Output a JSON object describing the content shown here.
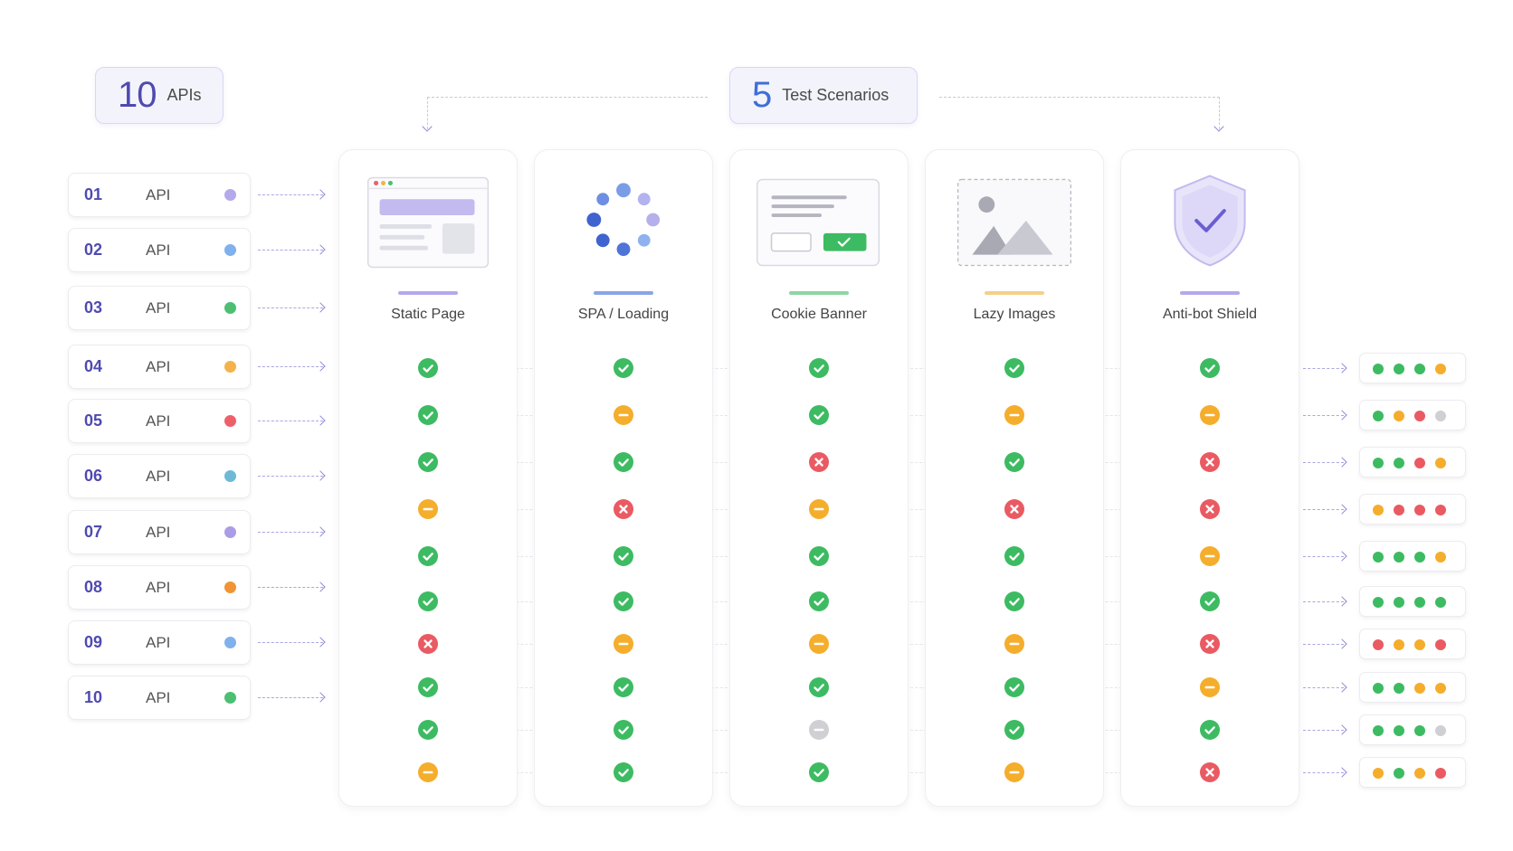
{
  "header": {
    "apis": {
      "count": "10",
      "label": "APIs"
    },
    "scenarios": {
      "count": "5",
      "label": "Test Scenarios"
    }
  },
  "apis": [
    {
      "index": "01",
      "name": "API",
      "color": "#b3a9ec"
    },
    {
      "index": "02",
      "name": "API",
      "color": "#7fb1ec"
    },
    {
      "index": "03",
      "name": "API",
      "color": "#4cbf73"
    },
    {
      "index": "04",
      "name": "API",
      "color": "#f4b34a"
    },
    {
      "index": "05",
      "name": "API",
      "color": "#ee6069"
    },
    {
      "index": "06",
      "name": "API",
      "color": "#6db9d6"
    },
    {
      "index": "07",
      "name": "API",
      "color": "#ab9ce6"
    },
    {
      "index": "08",
      "name": "API",
      "color": "#f19436"
    },
    {
      "index": "09",
      "name": "API",
      "color": "#7fb1ec"
    },
    {
      "index": "10",
      "name": "API",
      "color": "#4cbf73"
    }
  ],
  "scenarios": [
    {
      "label": "Static Page",
      "icon": "browser-window-icon",
      "accent": "#b5a9ec"
    },
    {
      "label": "SPA / Loading",
      "icon": "loading-spinner-icon",
      "accent": "#8aa5e6"
    },
    {
      "label": "Cookie Banner",
      "icon": "cookie-consent-icon",
      "accent": "#8ed6a3"
    },
    {
      "label": "Lazy Images",
      "icon": "image-placeholder-icon",
      "accent": "#f6cf8a"
    },
    {
      "label": "Anti-bot Shield",
      "icon": "shield-check-icon",
      "accent": "#b5a9ec"
    }
  ],
  "status_colors": {
    "pass": "#3dbb62",
    "partial": "#f5ad2c",
    "fail": "#ea5a62",
    "na": "#cfcfd4"
  },
  "matrix": [
    [
      "pass",
      "pass",
      "pass",
      "pass",
      "pass"
    ],
    [
      "pass",
      "partial",
      "pass",
      "partial",
      "partial"
    ],
    [
      "pass",
      "pass",
      "fail",
      "pass",
      "fail"
    ],
    [
      "partial",
      "fail",
      "partial",
      "fail",
      "fail"
    ],
    [
      "pass",
      "pass",
      "pass",
      "pass",
      "partial"
    ],
    [
      "pass",
      "pass",
      "pass",
      "pass",
      "pass"
    ],
    [
      "fail",
      "partial",
      "partial",
      "partial",
      "fail"
    ],
    [
      "pass",
      "pass",
      "pass",
      "pass",
      "partial"
    ],
    [
      "pass",
      "pass",
      "na",
      "pass",
      "pass"
    ],
    [
      "partial",
      "pass",
      "pass",
      "partial",
      "fail"
    ]
  ],
  "summaries": [
    [
      "pass",
      "pass",
      "pass",
      "partial"
    ],
    [
      "pass",
      "partial",
      "fail",
      "na"
    ],
    [
      "pass",
      "pass",
      "fail",
      "partial"
    ],
    [
      "partial",
      "fail",
      "fail",
      "fail"
    ],
    [
      "pass",
      "pass",
      "pass",
      "partial"
    ],
    [
      "pass",
      "pass",
      "pass",
      "pass"
    ],
    [
      "fail",
      "partial",
      "partial",
      "fail"
    ],
    [
      "pass",
      "pass",
      "partial",
      "partial"
    ],
    [
      "pass",
      "pass",
      "pass",
      "na"
    ],
    [
      "partial",
      "pass",
      "partial",
      "fail"
    ]
  ]
}
